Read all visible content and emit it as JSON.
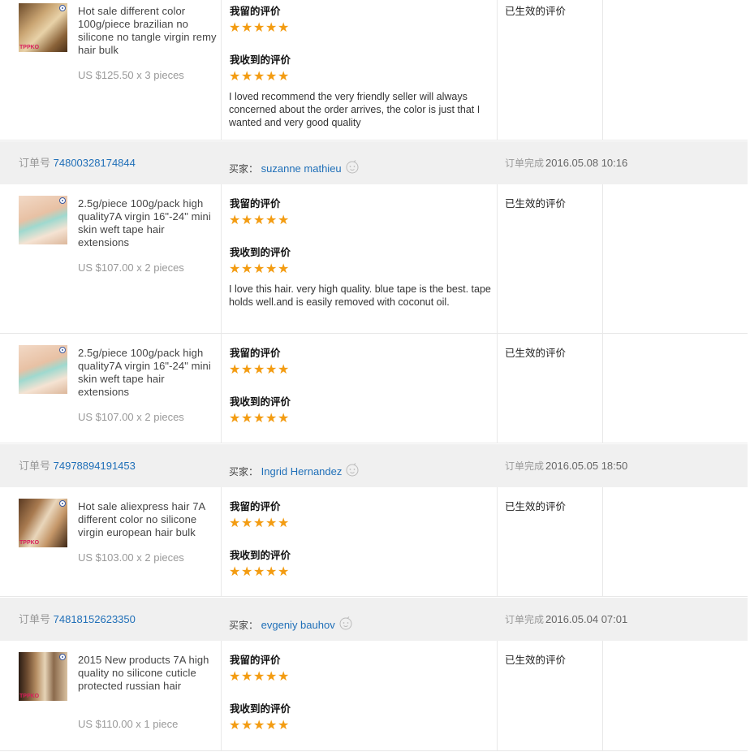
{
  "labels": {
    "my_review": "我留的评价",
    "received_review": "我收到的评价",
    "status": "已生效的评价",
    "order_prefix": "订单号",
    "buyer_prefix": "买家：",
    "completed_prefix": "订单完成"
  },
  "rating_stars": 5,
  "colors": {
    "star": "#f39c12",
    "link": "#1f6fb8",
    "header_bg": "#f0f0f0"
  },
  "item_1": {
    "thumb_brand": "TPPKO",
    "title": "Hot sale different color 100g/piece brazilian no silicone no tangle virgin remy hair bulk",
    "price": "US $125.50 x 3 pieces",
    "received_text": "I loved recommend the very friendly seller will always concerned about the order arrives, the color is just that I wanted and very good quality"
  },
  "order_1": {
    "number": "74800328174844",
    "buyer": "suzanne mathieu",
    "completed": "2016.05.08 10:16"
  },
  "item_2": {
    "title": "2.5g/piece 100g/pack high quality7A virgin 16\"-24\" mini skin weft tape hair extensions",
    "price": "US $107.00 x 2 pieces",
    "received_text": "I love this hair. very high quality. blue tape is the best. tape holds well.and is easily removed with coconut oil."
  },
  "item_3": {
    "title": "2.5g/piece 100g/pack high quality7A virgin 16\"-24\" mini skin weft tape hair extensions",
    "price": "US $107.00 x 2 pieces"
  },
  "order_2": {
    "number": "74978894191453",
    "buyer": "Ingrid Hernandez",
    "completed": "2016.05.05 18:50"
  },
  "item_4": {
    "thumb_brand": "TPPKO",
    "title": "Hot sale aliexpress hair 7A different color no silicone virgin european hair bulk",
    "price": "US $103.00 x 2 pieces"
  },
  "order_3": {
    "number": "74818152623350",
    "buyer": "evgeniy bauhov",
    "completed": "2016.05.04 07:01"
  },
  "item_5": {
    "thumb_brand": "TPPKO",
    "title": "2015 New products 7A high quality no silicone cuticle protected russian hair",
    "price": "US $110.00 x 1 piece"
  }
}
